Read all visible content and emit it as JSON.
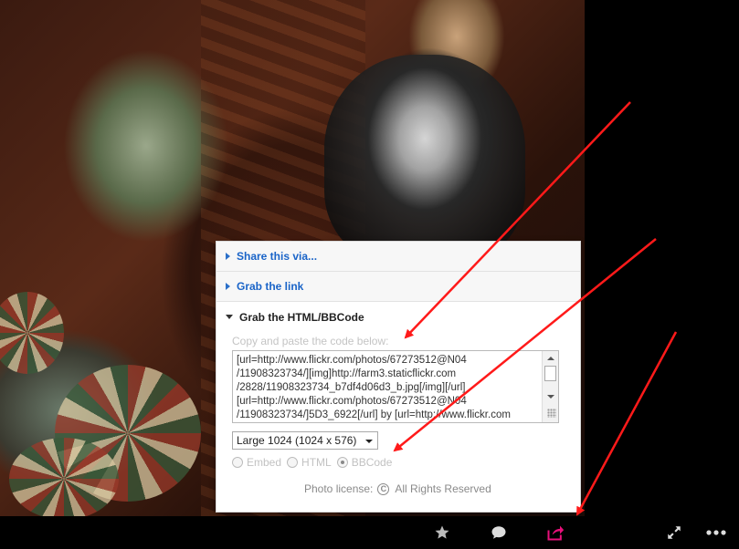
{
  "share_panel": {
    "sections": [
      {
        "label": "Share this via...",
        "expanded": false
      },
      {
        "label": "Grab the link",
        "expanded": false
      },
      {
        "label": "Grab the HTML/BBCode",
        "expanded": true
      }
    ],
    "code_hint": "Copy and paste the code below:",
    "code_value": "[url=http://www.flickr.com/photos/67273512@N04\n/11908323734/][img]http://farm3.staticflickr.com\n/2828/11908323734_b7df4d06d3_b.jpg[/img][/url]\n[url=http://www.flickr.com/photos/67273512@N04\n/11908323734/]5D3_6922[/url] by [url=http://www.flickr.com",
    "size_select": {
      "selected": "Large 1024 (1024 x 576)"
    },
    "format_options": [
      {
        "label": "Embed",
        "selected": false
      },
      {
        "label": "HTML",
        "selected": false
      },
      {
        "label": "BBCode",
        "selected": true
      }
    ],
    "license_label": "Photo license:",
    "license_symbol": "C",
    "license_value": "All Rights Reserved"
  },
  "toolbar": {
    "icons": [
      {
        "name": "star-icon",
        "glyph": "★",
        "color": "#bbbbbb"
      },
      {
        "name": "comment-icon",
        "glyph": "💬",
        "color": "#dddddd"
      },
      {
        "name": "share-icon",
        "glyph": "share",
        "color": "#e8107a"
      },
      {
        "name": "fullscreen-icon",
        "glyph": "⤢",
        "color": "#dddddd"
      },
      {
        "name": "more-icon",
        "glyph": "•••",
        "color": "#dddddd"
      }
    ]
  },
  "annotation_color": "#ff1a1a"
}
